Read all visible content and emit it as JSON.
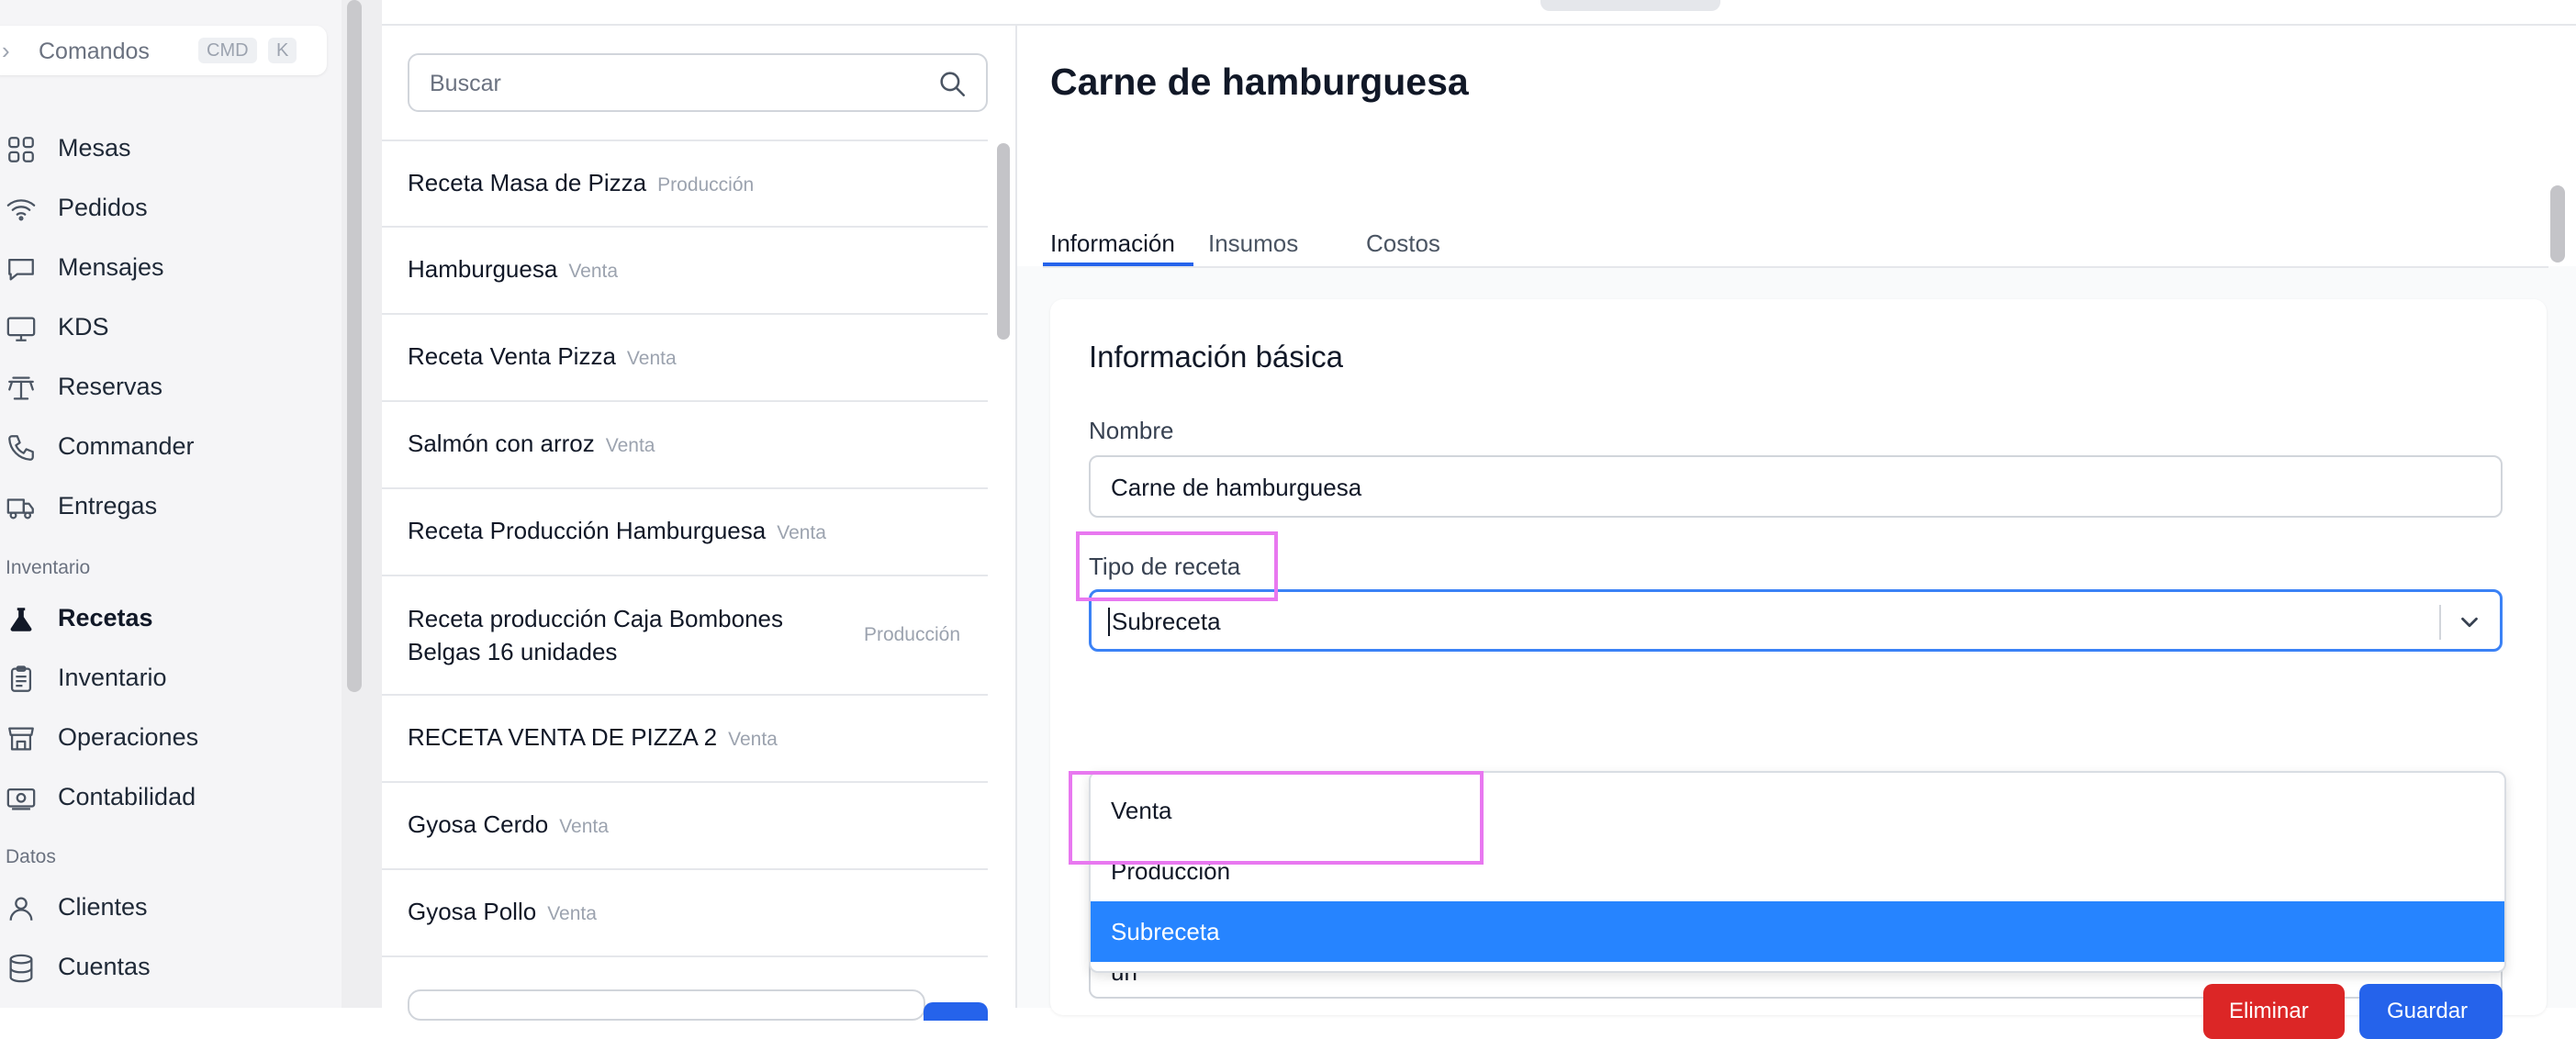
{
  "command_bar": {
    "label": "Comandos",
    "key1": "CMD",
    "key2": "K"
  },
  "sidebar": {
    "items": [
      {
        "label": "Mesas",
        "icon": "grid-icon"
      },
      {
        "label": "Pedidos",
        "icon": "wifi-icon"
      },
      {
        "label": "Mensajes",
        "icon": "chat-icon"
      },
      {
        "label": "KDS",
        "icon": "monitor-icon"
      },
      {
        "label": "Reservas",
        "icon": "table-icon"
      },
      {
        "label": "Commander",
        "icon": "phone-icon"
      },
      {
        "label": "Entregas",
        "icon": "truck-icon"
      }
    ],
    "inventory_section": "Inventario",
    "inventory_items": [
      {
        "label": "Recetas",
        "icon": "flask-icon",
        "active": true
      },
      {
        "label": "Inventario",
        "icon": "clipboard-icon"
      },
      {
        "label": "Operaciones",
        "icon": "store-icon"
      },
      {
        "label": "Contabilidad",
        "icon": "cash-icon"
      }
    ],
    "data_section": "Datos",
    "data_items": [
      {
        "label": "Clientes",
        "icon": "user-icon"
      },
      {
        "label": "Cuentas",
        "icon": "database-icon"
      }
    ]
  },
  "search": {
    "placeholder": "Buscar"
  },
  "recipes": [
    {
      "name": "Receta Masa de Pizza",
      "type": "Producción"
    },
    {
      "name": "Hamburguesa",
      "type": "Venta"
    },
    {
      "name": "Receta Venta Pizza",
      "type": "Venta"
    },
    {
      "name": "Salmón con arroz",
      "type": "Venta"
    },
    {
      "name": "Receta Producción Hamburguesa",
      "type": "Venta"
    },
    {
      "name_line1": "Receta producción Caja Bombones",
      "name_line2": "Belgas 16 unidades",
      "type": "Producción"
    },
    {
      "name": "RECETA VENTA DE PIZZA 2",
      "type": "Venta"
    },
    {
      "name": "Gyosa Cerdo",
      "type": "Venta"
    },
    {
      "name": "Gyosa Pollo",
      "type": "Venta"
    }
  ],
  "detail": {
    "title": "Carne de hamburguesa",
    "tabs": [
      "Información",
      "Insumos",
      "Costos"
    ],
    "section_title": "Información básica",
    "name_label": "Nombre",
    "name_value": "Carne de hamburguesa",
    "type_label": "Tipo de receta",
    "type_value": "Subreceta",
    "options": [
      "Venta",
      "Producción",
      "Subreceta"
    ],
    "unit_value": "un",
    "delete_label": "Eliminar",
    "save_label": "Guardar"
  },
  "colors": {
    "accent": "#2563eb",
    "selected_option": "#2684ff",
    "highlight": "#e878f0",
    "danger": "#dc2626"
  }
}
